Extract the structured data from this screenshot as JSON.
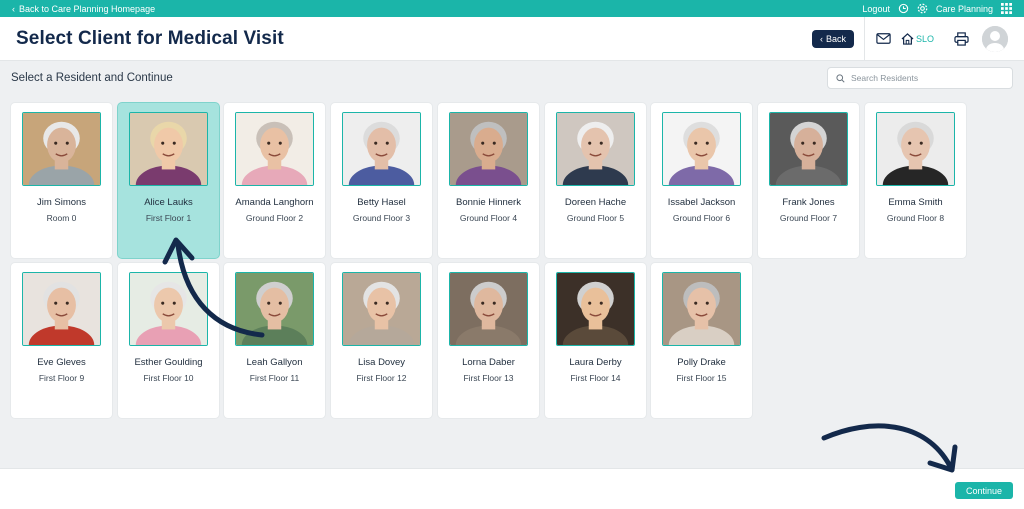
{
  "topbar": {
    "back_link": "Back to Care Planning Homepage",
    "logout": "Logout",
    "app_name": "Care Planning"
  },
  "header": {
    "title": "Select Client for Medical Visit",
    "back_button": "Back",
    "slo_label": "SLO"
  },
  "main": {
    "subtitle": "Select a Resident and Continue",
    "search_placeholder": "Search Residents"
  },
  "residents": [
    {
      "name": "Jim Simons",
      "room": "Room 0",
      "selected": false,
      "skin": "#d9b49a",
      "hair": "#e8e8e8",
      "shirt": "#9aa4a8",
      "bg": "#c7a57a"
    },
    {
      "name": "Alice Lauks",
      "room": "First Floor 1",
      "selected": true,
      "skin": "#f0c9a8",
      "hair": "#e9d7a9",
      "shirt": "#7a3b6e",
      "bg": "#d9c9b0"
    },
    {
      "name": "Amanda Langhorn",
      "room": "Ground Floor 2",
      "selected": false,
      "skin": "#e9c1a4",
      "hair": "#c9c0b8",
      "shirt": "#e7a9b9",
      "bg": "#f2ede6"
    },
    {
      "name": "Betty Hasel",
      "room": "Ground Floor 3",
      "selected": false,
      "skin": "#e3bea8",
      "hair": "#dcdcdc",
      "shirt": "#4c5ca0",
      "bg": "#eeeeee"
    },
    {
      "name": "Bonnie Hinnerk",
      "room": "Ground Floor 4",
      "selected": false,
      "skin": "#d9ac8e",
      "hair": "#bfbfbf",
      "shirt": "#7a4f8e",
      "bg": "#a99b8c"
    },
    {
      "name": "Doreen Hache",
      "room": "Ground Floor 5",
      "selected": false,
      "skin": "#e4c3ae",
      "hair": "#eeeeee",
      "shirt": "#2e3a4e",
      "bg": "#cfc7c0"
    },
    {
      "name": "Issabel Jackson",
      "room": "Ground Floor 6",
      "selected": false,
      "skin": "#eac6aa",
      "hair": "#dedede",
      "shirt": "#7e6aa8",
      "bg": "#f4f4f4"
    },
    {
      "name": "Frank Jones",
      "room": "Ground Floor 7",
      "selected": false,
      "skin": "#d6b09a",
      "hair": "#d4d4d4",
      "shirt": "#6b6b6b",
      "bg": "#5a5a5a"
    },
    {
      "name": "Emma Smith",
      "room": "Ground Floor 8",
      "selected": false,
      "skin": "#e6c5b0",
      "hair": "#d9d9d9",
      "shirt": "#262626",
      "bg": "#ececec"
    },
    {
      "name": "Eve Gleves",
      "room": "First Floor 9",
      "selected": false,
      "skin": "#e7bfa4",
      "hair": "#e2e2e2",
      "shirt": "#c0392b",
      "bg": "#e8e3de"
    },
    {
      "name": "Esther Goulding",
      "room": "First Floor 10",
      "selected": false,
      "skin": "#ecc8ac",
      "hair": "#e6e6e6",
      "shirt": "#e8a0b4",
      "bg": "#e6ece4"
    },
    {
      "name": "Leah Gallyon",
      "room": "First Floor 11",
      "selected": false,
      "skin": "#e4bea3",
      "hair": "#cfcfcf",
      "shirt": "#5c7f5a",
      "bg": "#7a9a6a"
    },
    {
      "name": "Lisa Dovey",
      "room": "First Floor 12",
      "selected": false,
      "skin": "#e8c2a6",
      "hair": "#e3e3e3",
      "shirt": "#b5a89a",
      "bg": "#b9a896"
    },
    {
      "name": "Lorna Daber",
      "room": "First Floor 13",
      "selected": false,
      "skin": "#dfb89e",
      "hair": "#cccccc",
      "shirt": "#8a7a6a",
      "bg": "#7d6e60"
    },
    {
      "name": "Laura Derby",
      "room": "First Floor 14",
      "selected": false,
      "skin": "#e9c09a",
      "hair": "#d0d0d0",
      "shirt": "#5a4a3a",
      "bg": "#3c3028"
    },
    {
      "name": "Polly Drake",
      "room": "First Floor 15",
      "selected": false,
      "skin": "#e6c1a8",
      "hair": "#bdbdbd",
      "shirt": "#d9cfc4",
      "bg": "#a89684"
    }
  ],
  "footer": {
    "continue_button": "Continue"
  },
  "colors": {
    "accent": "#1bb5a9",
    "navy": "#13294b",
    "selected_card": "#a6e3de"
  }
}
